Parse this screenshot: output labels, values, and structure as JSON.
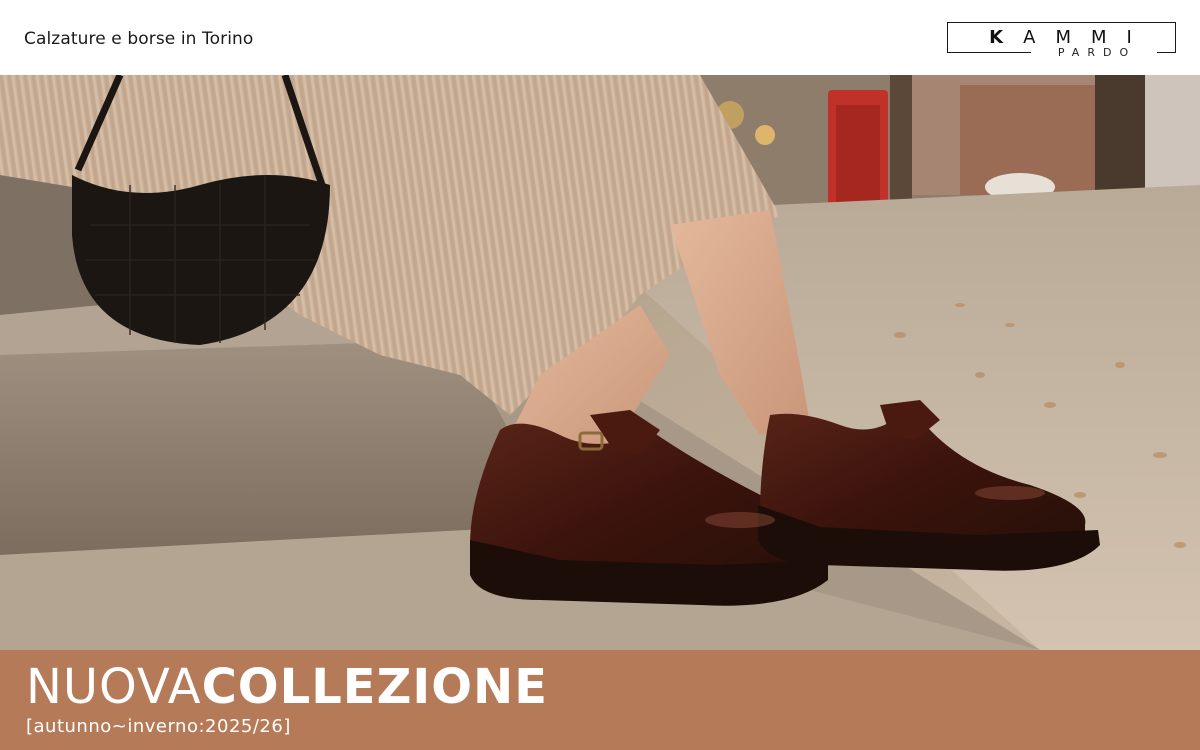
{
  "header": {
    "tagline": "Calzature e borse in Torino",
    "logo": {
      "main": "KAMMI",
      "sub": "PARDO"
    }
  },
  "hero": {
    "image_icon": "hero-photo-shoes-bag-icon"
  },
  "banner": {
    "headline_light": "NUOVA",
    "headline_bold": "COLLEZIONE",
    "subline": "[autunno~inverno:2025/26]",
    "background_color": "#b57a57",
    "text_color": "#ffffff"
  }
}
